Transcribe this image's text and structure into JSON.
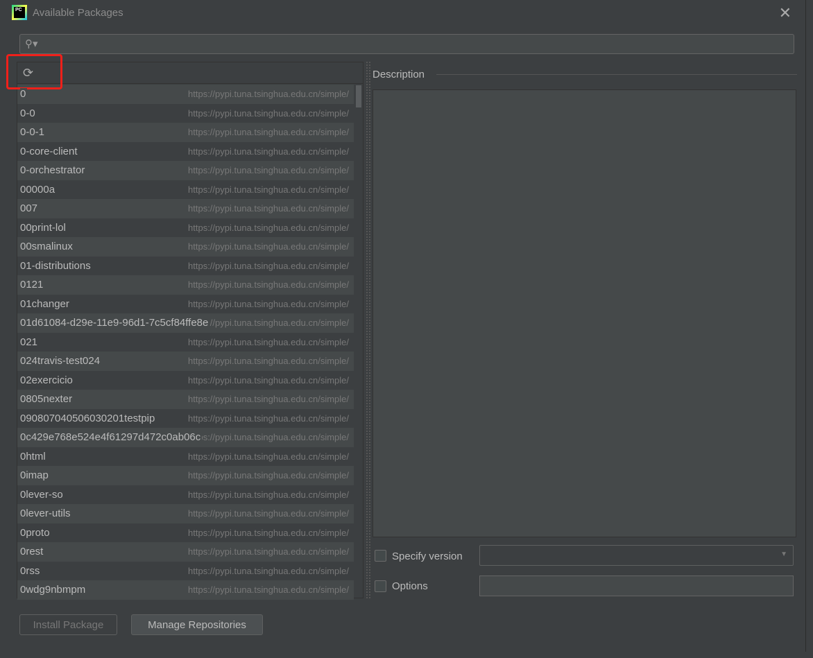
{
  "dialog": {
    "title": "Available Packages",
    "logo_text": "PC"
  },
  "search": {
    "placeholder": ""
  },
  "packages": [
    {
      "name": "0",
      "url": "https://pypi.tuna.tsinghua.edu.cn/simple/"
    },
    {
      "name": "0-0",
      "url": "https://pypi.tuna.tsinghua.edu.cn/simple/"
    },
    {
      "name": "0-0-1",
      "url": "https://pypi.tuna.tsinghua.edu.cn/simple/"
    },
    {
      "name": "0-core-client",
      "url": "https://pypi.tuna.tsinghua.edu.cn/simple/"
    },
    {
      "name": "0-orchestrator",
      "url": "https://pypi.tuna.tsinghua.edu.cn/simple/"
    },
    {
      "name": "00000a",
      "url": "https://pypi.tuna.tsinghua.edu.cn/simple/"
    },
    {
      "name": "007",
      "url": "https://pypi.tuna.tsinghua.edu.cn/simple/"
    },
    {
      "name": "00print-lol",
      "url": "https://pypi.tuna.tsinghua.edu.cn/simple/"
    },
    {
      "name": "00smalinux",
      "url": "https://pypi.tuna.tsinghua.edu.cn/simple/"
    },
    {
      "name": "01-distributions",
      "url": "https://pypi.tuna.tsinghua.edu.cn/simple/"
    },
    {
      "name": "0121",
      "url": "https://pypi.tuna.tsinghua.edu.cn/simple/"
    },
    {
      "name": "01changer",
      "url": "https://pypi.tuna.tsinghua.edu.cn/simple/"
    },
    {
      "name": "01d61084-d29e-11e9-96d1-7c5cf84ffe8e",
      "url": "https://pypi.tuna.tsinghua.edu.cn/simple/"
    },
    {
      "name": "021",
      "url": "https://pypi.tuna.tsinghua.edu.cn/simple/"
    },
    {
      "name": "024travis-test024",
      "url": "https://pypi.tuna.tsinghua.edu.cn/simple/"
    },
    {
      "name": "02exercicio",
      "url": "https://pypi.tuna.tsinghua.edu.cn/simple/"
    },
    {
      "name": "0805nexter",
      "url": "https://pypi.tuna.tsinghua.edu.cn/simple/"
    },
    {
      "name": "090807040506030201testpip",
      "url": "https://pypi.tuna.tsinghua.edu.cn/simple/"
    },
    {
      "name": "0c429e768e524e4f61297d472c0ab06c",
      "url": "https://pypi.tuna.tsinghua.edu.cn/simple/"
    },
    {
      "name": "0html",
      "url": "https://pypi.tuna.tsinghua.edu.cn/simple/"
    },
    {
      "name": "0imap",
      "url": "https://pypi.tuna.tsinghua.edu.cn/simple/"
    },
    {
      "name": "0lever-so",
      "url": "https://pypi.tuna.tsinghua.edu.cn/simple/"
    },
    {
      "name": "0lever-utils",
      "url": "https://pypi.tuna.tsinghua.edu.cn/simple/"
    },
    {
      "name": "0proto",
      "url": "https://pypi.tuna.tsinghua.edu.cn/simple/"
    },
    {
      "name": "0rest",
      "url": "https://pypi.tuna.tsinghua.edu.cn/simple/"
    },
    {
      "name": "0rss",
      "url": "https://pypi.tuna.tsinghua.edu.cn/simple/"
    },
    {
      "name": "0wdg9nbmpm",
      "url": "https://pypi.tuna.tsinghua.edu.cn/simple/"
    }
  ],
  "description": {
    "label": "Description",
    "text": ""
  },
  "specify_version": {
    "label": "Specify version",
    "checked": false,
    "value": ""
  },
  "options": {
    "label": "Options",
    "checked": false,
    "value": ""
  },
  "buttons": {
    "install": "Install Package",
    "manage": "Manage Repositories"
  },
  "colors": {
    "highlight": "#f0201a",
    "background": "#3c3f41"
  }
}
